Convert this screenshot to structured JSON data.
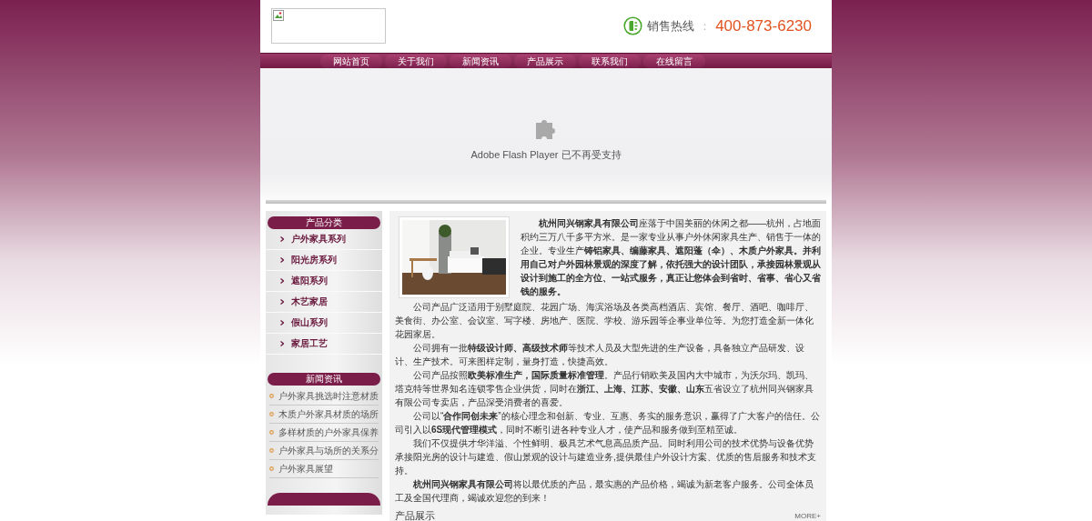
{
  "header": {
    "hotline": {
      "label": "销售热线",
      "separator": "：",
      "number": "400-873-6230"
    }
  },
  "nav": {
    "items": [
      {
        "label": "网站首页"
      },
      {
        "label": "关于我们"
      },
      {
        "label": "新闻资讯"
      },
      {
        "label": "产品展示"
      },
      {
        "label": "联系我们"
      },
      {
        "label": "在线留言"
      }
    ]
  },
  "flash": {
    "message": "Adobe Flash Player 已不再受支持"
  },
  "sidebar": {
    "product_categories": {
      "title": "产品分类",
      "items": [
        "户外家具系列",
        "阳光房系列",
        "遮阳系列",
        "木艺家居",
        "假山系列",
        "家居工艺"
      ]
    },
    "news": {
      "title": "新闻资讯",
      "items": [
        "户外家具挑选时注意材质",
        "木质户外家具材质的场所",
        "多样材质的户外家具保养",
        "户外家具与场所的关系分",
        "户外家具展望"
      ]
    }
  },
  "content": {
    "paragraphs": [
      "**杭州同兴钢家具有限公司**座落于中国美丽的休闲之都——杭州，占地面积约三万八千多平方米。是一家专业从事户外休闲家具生产、销售于一体的企业。专业生产**铸铝家具、编藤家具、遮阳蓬（伞）、木质户外家具。并利用自己对户外园林景观的深度了解，依托强大的设计团队，承接园林景观从设计到施工的全方位、一站式服务，真正让您体会到省时、省事、省心又省钱的服务。**",
      "公司产品广泛适用于别墅庭院、花园广场、海滨浴场及各类高档酒店、宾馆、餐厅、酒吧、咖啡厅、美食街、办公室、会议室、写字楼、房地产、医院、学校、游乐园等企事业单位等。为您打造全新一体化花园家居。",
      "公司拥有一批**特级设计师、高级技术师**等技术人员及大型先进的生产设备，具备独立产品研发、设计、生产技术。可来图样定制，量身打造，快捷高效。",
      "公司产品按照**欧美标准生产，国际质量标准管理**。产品行销欧美及国内大中城市，为沃尔玛、凯玛、塔克特等世界知名连锁零售企业供货，同时在**浙江、上海、江苏、安徽、山东**五省设立了杭州同兴钢家具有限公司专卖店，产品深受消费者的喜爱。",
      "公司以“**合作同创未来**”的核心理念和创新、专业、互惠、务实的服务意识，赢得了广大客户的信任。公司引入以**6S现代管理模式**，同时不断引进各种专业人才，使产品和服务做到至精至诚。",
      "我们不仅提供才华洋溢、个性鲜明、极具艺术气息高品质产品。同时利用公司的技术优势与设备优势承接阳光房的设计与建造、假山景观的设计与建造业务,提供最佳户外设计方案、优质的售后服务和技术支持。",
      "**杭州同兴钢家具有限公司**将以最优质的产品，最实惠的产品价格，竭诚为新老客户服务。公司全体员工及全国代理商，竭诚欢迎您的到来！"
    ],
    "section": {
      "title": "产品展示",
      "more": "MORE+"
    }
  }
}
